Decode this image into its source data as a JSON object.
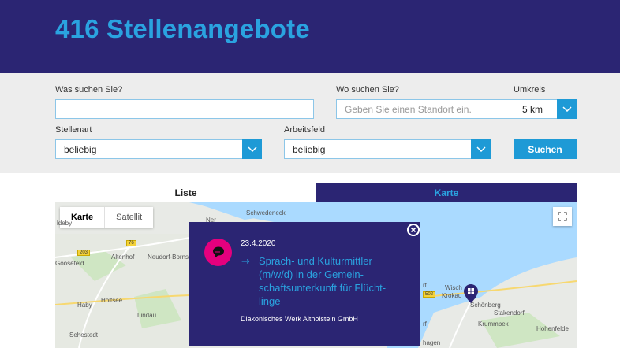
{
  "header": {
    "title": "416 Stellenangebote"
  },
  "search": {
    "what_label": "Was suchen Sie?",
    "what_value": "",
    "where_label": "Wo suchen Sie?",
    "where_placeholder": "Geben Sie einen Standort ein.",
    "radius_label": "Umkreis",
    "radius_value": "5 km",
    "type_label": "Stellenart",
    "type_value": "beliebig",
    "field_label": "Arbeitsfeld",
    "field_value": "beliebig",
    "submit_label": "Suchen"
  },
  "tabs": [
    {
      "label": "Liste",
      "active": false
    },
    {
      "label": "Karte",
      "active": true
    }
  ],
  "map": {
    "type_buttons": [
      "Karte",
      "Satellit"
    ],
    "places": [
      "Schwedeneck",
      "Altenhof",
      "Neudorf-Bornstein",
      "Goosefeld",
      "Holtsee",
      "Haby",
      "Lindau",
      "Sehestedt",
      "Wisch",
      "Krokau",
      "Schönberg",
      "Stakendorf",
      "Krummbek",
      "Hohenfelde",
      "hagen",
      "Ner",
      "rf",
      "rf",
      "rf",
      "rf",
      "ldeby"
    ],
    "roads": [
      "203",
      "76",
      "502"
    ]
  },
  "popup": {
    "date": "23.4.2020",
    "title": "Sprach- und Kulturmittler (m/w/d) in der Gemein-schaftsunterkunft für Flücht-linge",
    "title_lines": [
      "Sprach- und Kulturmittler",
      "(m/w/d) in der Gemein-",
      "schaftsunterkunft für Flücht-",
      "linge"
    ],
    "company": "Diakonisches Werk Altholstein GmbH"
  },
  "colors": {
    "header_bg": "#2b2573",
    "accent": "#1e9ad6",
    "title_blue": "#2aa3e0",
    "icon_pink": "#e5007e"
  }
}
